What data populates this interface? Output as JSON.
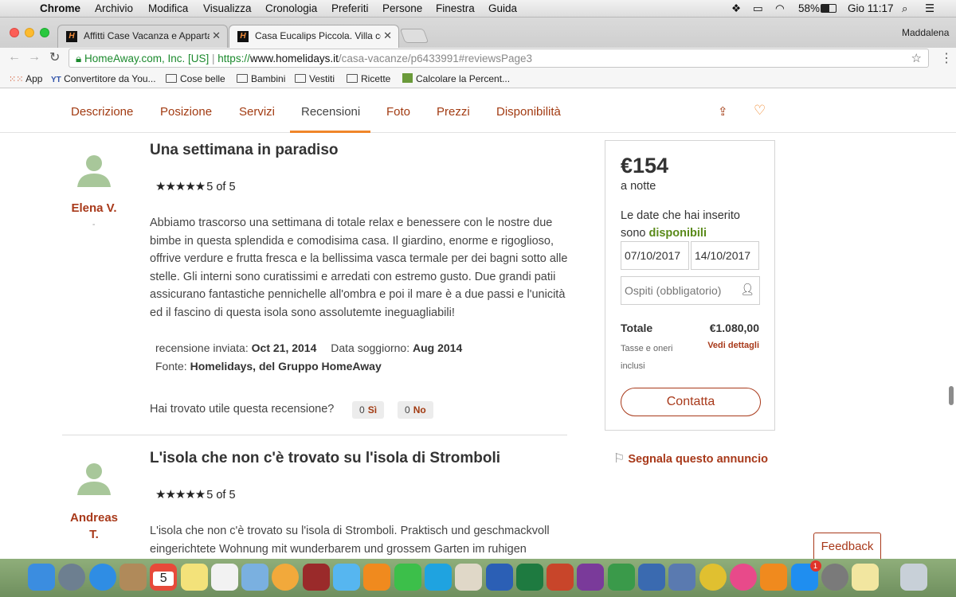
{
  "menubar": {
    "apple": "",
    "items": [
      "Chrome",
      "Archivio",
      "Modifica",
      "Visualizza",
      "Cronologia",
      "Preferiti",
      "Persone",
      "Finestra",
      "Guida"
    ],
    "battery": "58%",
    "clock": "Gio 11:17"
  },
  "browser": {
    "profile": "Maddalena",
    "tabs": [
      {
        "title": "Affitti Case Vacanza e Apparta",
        "favicon": "H"
      },
      {
        "title": "Casa Eucalips Piccola. Villa co",
        "favicon": "H"
      }
    ],
    "url_org": "HomeAway.com, Inc. [US]",
    "url_scheme": "https://",
    "url_host": "www.homelidays.it",
    "url_path": "/casa-vacanze/p6433991#reviewsPage3",
    "bookmarks": [
      "App",
      "Convertitore da You...",
      "Cose belle",
      "Bambini",
      "Vestiti",
      "Ricette",
      "Calcolare la Percent..."
    ]
  },
  "nav": {
    "items": [
      "Descrizione",
      "Posizione",
      "Servizi",
      "Recensioni",
      "Foto",
      "Prezzi",
      "Disponibilità"
    ],
    "active": "Recensioni"
  },
  "reviews": [
    {
      "author": "Elena V.",
      "title": "Una settimana in paradiso",
      "rating": 5,
      "rating_text": "5 of 5",
      "body": "Abbiamo trascorso una settimana di totale relax e benessere con le nostre due bimbe in questa splendida e comodisima casa. Il giardino, enorme e rigoglioso, offrive verdure e frutta fresca e la bellissima vasca termale per dei bagni sotto alle stelle. Gli interni sono curatissimi e arredati con estremo gusto. Due grandi patii assicurano fantastiche pennichelle all'ombra e poi il mare è a due passi e l'unicità ed il fascino di questa isola sono assolutemte ineguagliabili!",
      "sent_label": "recensione inviata:",
      "sent_date": "Oct 21, 2014",
      "stay_label": "Data soggiorno:",
      "stay_date": "Aug 2014",
      "source_label": "Fonte:",
      "source": "Homelidays, del Gruppo HomeAway",
      "helpful_q": "Hai trovato utile questa recensione?",
      "yes_count": "0",
      "yes_label": "Sì",
      "no_count": "0",
      "no_label": "No"
    },
    {
      "author_line1": "Andreas",
      "author_line2": "T.",
      "title": "L'isola che non c'è trovato su l'isola di Stromboli",
      "rating": 5,
      "rating_text": "5 of 5",
      "body": "L'isola che non c'è trovato su l'isola di Stromboli. Praktisch und geschmackvoll eingerichtete Wohnung mit wunderbarem und grossem Garten im ruhigen"
    }
  ],
  "booking": {
    "price": "€154",
    "per": "a notte",
    "avail_text1": "Le date che hai inserito",
    "avail_text2": "sono",
    "avail_word": "disponibili",
    "checkin": "07/10/2017",
    "checkout": "14/10/2017",
    "guests_placeholder": "Ospiti (obbligatorio)",
    "total_label": "Totale",
    "total_value": "€1.080,00",
    "taxes1": "Tasse e oneri",
    "taxes2": "inclusi",
    "details_link": "Vedi dettagli",
    "contact": "Contatta",
    "report": "Segnala questo annuncio"
  },
  "feedback": "Feedback",
  "colors": {
    "accent": "#a8391a",
    "orange": "#f0862a",
    "green": "#5a8a1a"
  },
  "dock_icons": [
    "finder-icon",
    "launchpad-icon",
    "safari-icon",
    "contacts-icon",
    "calendar-icon",
    "notes-icon",
    "reminders-icon",
    "preview-icon",
    "photos-icon",
    "photo-booth-icon",
    "messages-icon",
    "vlc-icon",
    "facetime-icon",
    "skype-icon",
    "textedit-icon",
    "word-icon",
    "excel-icon",
    "powerpoint-icon",
    "onenote-icon",
    "numbers-icon",
    "keynote-icon",
    "preview2-icon",
    "chrome-icon",
    "itunes-icon",
    "ibooks-icon",
    "app-store-icon",
    "system-preferences-icon",
    "stickies-icon",
    "trash-icon"
  ],
  "dock_calendar_day": "5",
  "appstore_badge": "1"
}
